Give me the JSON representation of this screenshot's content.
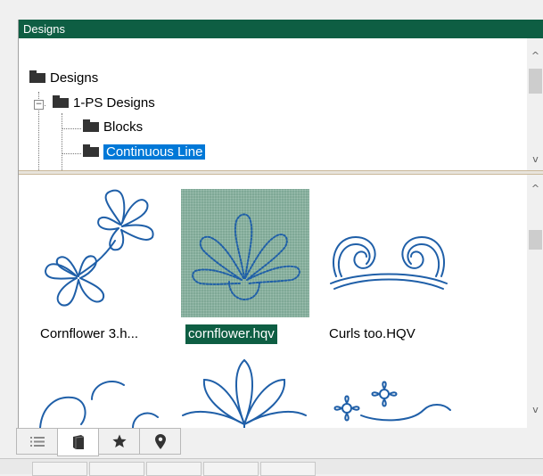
{
  "panel": {
    "title": "Designs"
  },
  "tree": {
    "items": [
      {
        "label": "Designs"
      },
      {
        "label": "1-PS Designs",
        "expander": "−"
      },
      {
        "label": "Blocks"
      },
      {
        "label": "Continuous Line",
        "selected": true
      }
    ]
  },
  "grid": {
    "items": [
      {
        "caption": "Cornflower 3.h..."
      },
      {
        "caption": "cornflower.hqv",
        "selected": true
      },
      {
        "caption": "Curls too.HQV"
      }
    ]
  },
  "scroll": {
    "up_icon": "^",
    "down_icon": "v"
  },
  "tabs": [
    {
      "icon": "list-icon"
    },
    {
      "icon": "book-icon",
      "active": true
    },
    {
      "icon": "star-icon"
    },
    {
      "icon": "location-pin-icon"
    }
  ],
  "colors": {
    "title_bg": "#0e5e43",
    "tree_selection": "#0078d7",
    "design_stroke": "#1f5fa8"
  }
}
